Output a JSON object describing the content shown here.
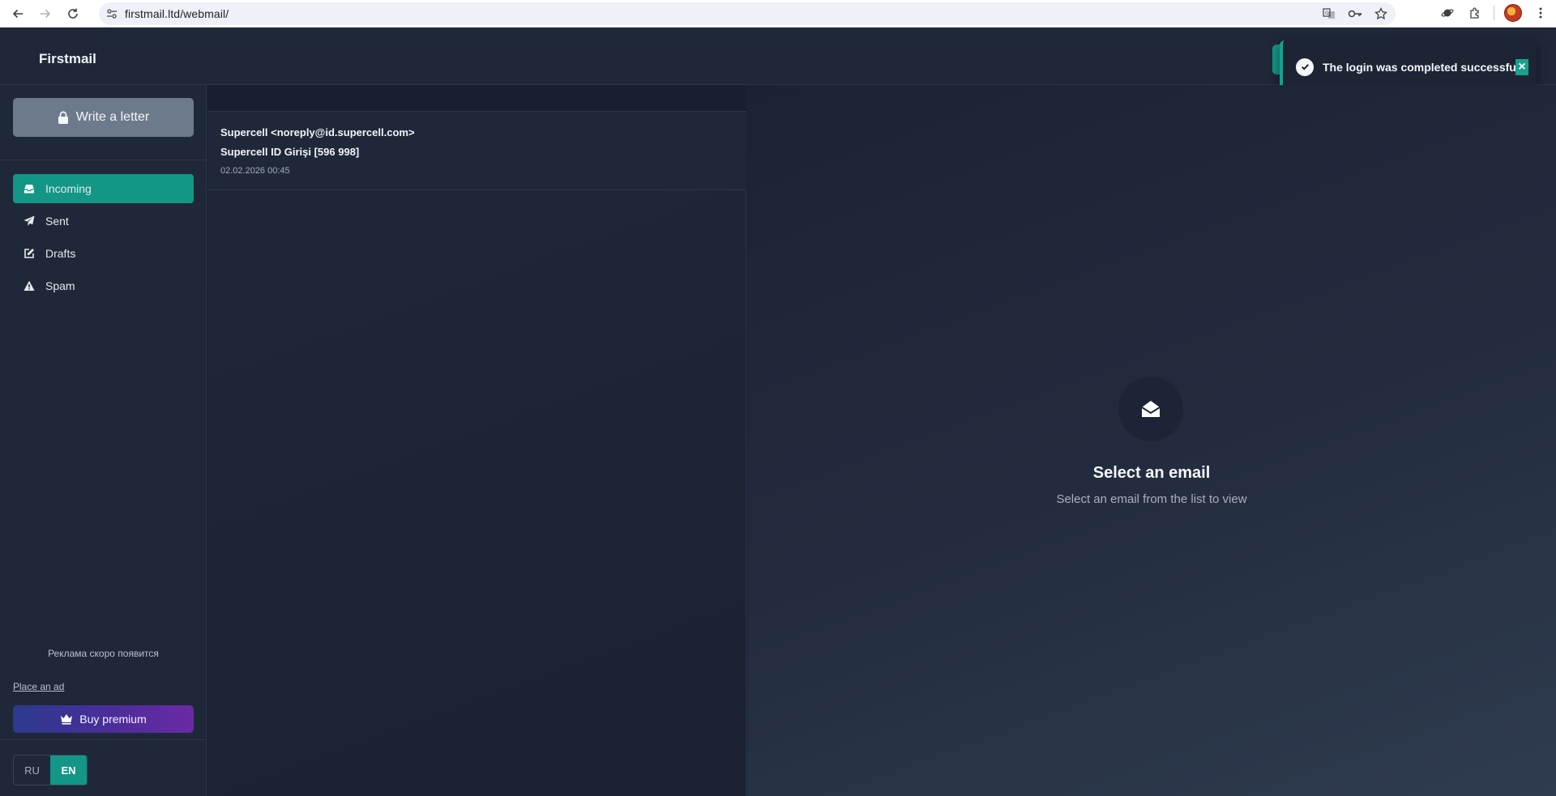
{
  "browser": {
    "url": "firstmail.ltd/webmail/"
  },
  "app": {
    "brand": "Firstmail"
  },
  "toast": {
    "message": "The login was completed successfully",
    "close_symbol": "×"
  },
  "sidebar": {
    "write_label": "Write a letter",
    "items": [
      {
        "label": "Incoming",
        "icon": "inbox-icon",
        "active": true
      },
      {
        "label": "Sent",
        "icon": "paper-plane-icon",
        "active": false
      },
      {
        "label": "Drafts",
        "icon": "edit-icon",
        "active": false
      },
      {
        "label": "Spam",
        "icon": "warning-icon",
        "active": false
      }
    ],
    "ad_text": "Реклама скоро появится",
    "place_ad": "Place an ad",
    "premium_label": "Buy premium",
    "languages": [
      "RU",
      "EN"
    ],
    "active_language": "EN"
  },
  "mail_list": {
    "items": [
      {
        "from": "Supercell <noreply@id.supercell.com>",
        "subject": "Supercell ID Girişi [596 998]",
        "date": "02.02.2026 00:45"
      }
    ]
  },
  "viewer": {
    "title": "Select an email",
    "subtitle": "Select an email from the list to view"
  },
  "colors": {
    "accent": "#149686",
    "background": "#1a2232",
    "panel": "#1f2839",
    "write_button": "#6d7a8c"
  }
}
